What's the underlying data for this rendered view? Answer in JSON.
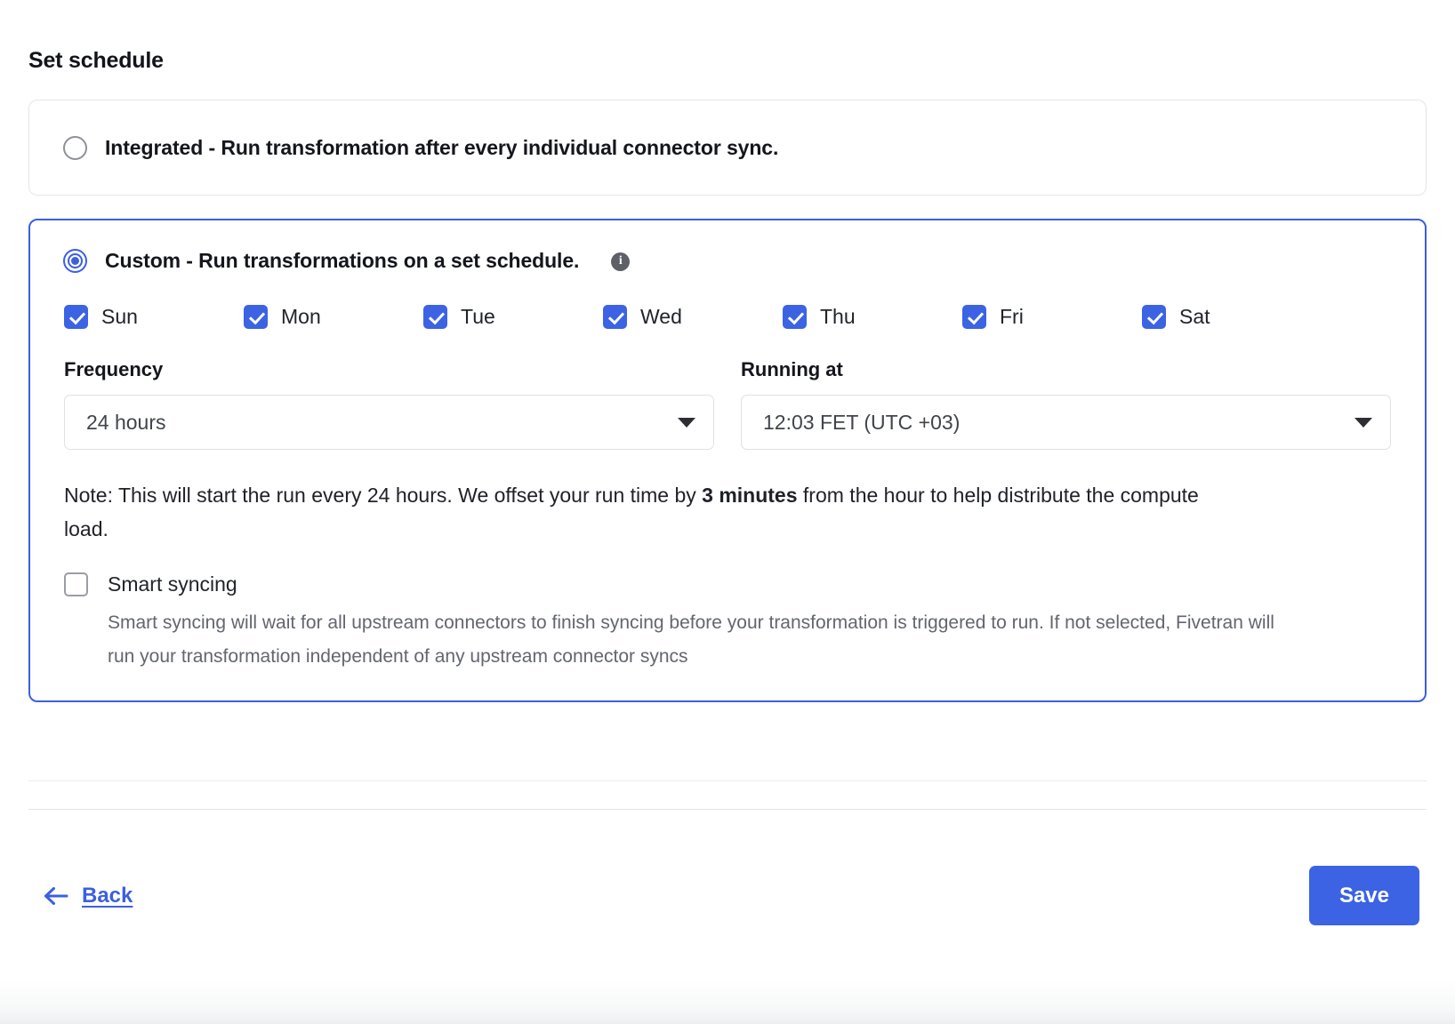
{
  "page": {
    "title": "Set schedule"
  },
  "options": [
    {
      "id": "integrated",
      "label": "Integrated - Run transformation after every individual connector sync.",
      "selected": false
    },
    {
      "id": "custom",
      "label": "Custom - Run transformations on a set schedule.",
      "selected": true,
      "info_icon": "info-icon",
      "info_glyph": "i"
    }
  ],
  "days": [
    {
      "label": "Sun",
      "checked": true
    },
    {
      "label": "Mon",
      "checked": true
    },
    {
      "label": "Tue",
      "checked": true
    },
    {
      "label": "Wed",
      "checked": true
    },
    {
      "label": "Thu",
      "checked": true
    },
    {
      "label": "Fri",
      "checked": true
    },
    {
      "label": "Sat",
      "checked": true
    }
  ],
  "frequency": {
    "label": "Frequency",
    "value": "24 hours",
    "caret_icon": "chevron-down-icon"
  },
  "running_at": {
    "label": "Running at",
    "value": "12:03 FET (UTC +03)",
    "caret_icon": "chevron-down-icon"
  },
  "note": {
    "part1": "Note: This will start the run every 24 hours. We offset your run time by ",
    "emphasis": "3 minutes",
    "part2": " from the hour to help distribute the compute load."
  },
  "smart_syncing": {
    "label": "Smart syncing",
    "checked": false,
    "description": "Smart syncing will wait for all upstream connectors to finish syncing before your transformation is triggered to run. If not selected, Fivetran will run your transformation independent of any upstream connector syncs"
  },
  "footer": {
    "back_label": "Back",
    "back_icon": "arrow-left-icon",
    "save_label": "Save"
  },
  "colors": {
    "accent": "#3b63e3",
    "link": "#3b5fe0",
    "selected_border": "#3b5fe0",
    "card_border": "#e3e5e8",
    "info_bg": "#5e6068",
    "text": "#1b1b1f",
    "muted_text": "#63666e"
  }
}
